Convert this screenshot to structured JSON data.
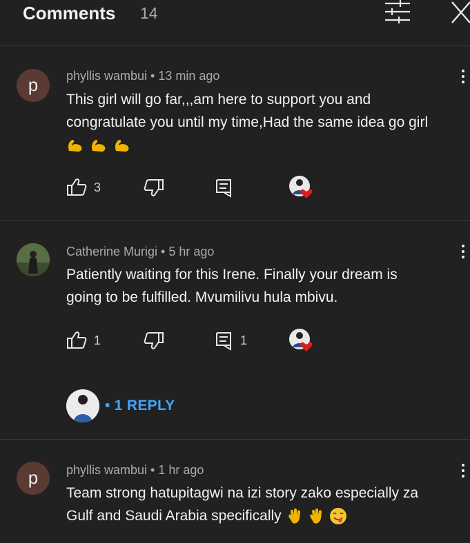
{
  "header": {
    "title": "Comments",
    "count": "14"
  },
  "comments": [
    {
      "avatar_letter": "p",
      "meta": "phyllis wambui • 13 min ago",
      "lines": [
        "This girl will go far,,,am here to support you and",
        "congratulate you until my time,Had the same idea go girl"
      ],
      "emojis": [
        "flexed-biceps",
        "flexed-biceps",
        "flexed-biceps"
      ],
      "likes": "3",
      "replies": ""
    },
    {
      "avatar_letter": "",
      "meta": "Catherine Murigi • 5 hr ago",
      "lines": [
        "Patiently waiting for this Irene. Finally your dream is",
        "going to be fulfilled. Mvumilivu hula mbivu."
      ],
      "likes": "1",
      "replies": "1",
      "reply_link": "• 1 REPLY"
    },
    {
      "avatar_letter": "p",
      "meta": "phyllis wambui • 1 hr ago",
      "lines": [
        "Team strong hatupitagwi na izi story zako especially za",
        "Gulf and Saudi Arabia specifically"
      ],
      "emojis": [
        "waving-hand",
        "waving-hand",
        "savoring-food-face"
      ]
    }
  ],
  "colors": {
    "background": "#212121",
    "text": "#f1f1f1",
    "secondary_text": "#aaaaaa",
    "link": "#3ea6ff",
    "letter_avatar": "#5b3a33",
    "heart": "#e01b1b"
  }
}
